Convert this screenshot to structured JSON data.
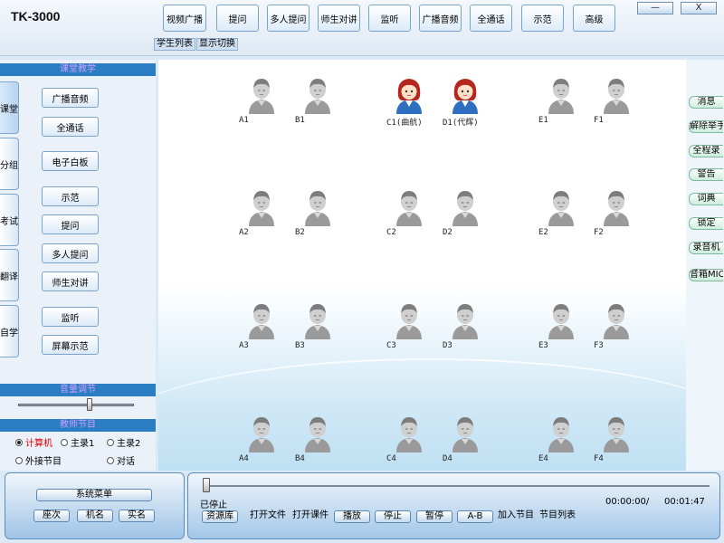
{
  "app": {
    "title": "TK-3000",
    "minimize_label": "—",
    "close_label": "X"
  },
  "toolbar": {
    "buttons": [
      "视频广播",
      "提问",
      "多人提问",
      "师生对讲",
      "监听",
      "广播音频",
      "全通话",
      "示范",
      "高级"
    ]
  },
  "subtabs": [
    "学生列表",
    "显示切换"
  ],
  "left_panel": {
    "header": "课堂教学",
    "vertical_tabs": [
      {
        "label": "课堂",
        "active": true
      },
      {
        "label": "分组",
        "active": false
      },
      {
        "label": "考试",
        "active": false
      },
      {
        "label": "翻译",
        "active": false
      },
      {
        "label": "自学",
        "active": false
      }
    ],
    "buttons": [
      "广播音频",
      "全通话",
      "电子白板",
      "示范",
      "提问",
      "多人提问",
      "师生对讲",
      "监听",
      "屏幕示范"
    ],
    "volume_header": "音量调节",
    "volume_level": 0.62,
    "program_header": "教师节目",
    "program_options": [
      {
        "label": "计算机",
        "checked": true
      },
      {
        "label": "主录1",
        "checked": false
      },
      {
        "label": "主录2",
        "checked": false
      },
      {
        "label": "外接节目",
        "checked": false
      },
      {
        "label": "对话",
        "checked": false
      }
    ]
  },
  "seats": [
    [
      "A1",
      "B1",
      "C1(曲航)",
      "D1(代辉)",
      "E1",
      "F1"
    ],
    [
      "A2",
      "B2",
      "C2",
      "D2",
      "E2",
      "F2"
    ],
    [
      "A3",
      "B3",
      "C3",
      "D3",
      "E3",
      "F3"
    ],
    [
      "A4",
      "B4",
      "C4",
      "D4",
      "E4",
      "F4"
    ]
  ],
  "online_seats": [
    "C1(曲航)",
    "D1(代辉)"
  ],
  "colors": {
    "online_hair": "#b5261e",
    "online_body": "#2f6fc1",
    "offline_body": "#9a9a9a",
    "header_bg": "#2b7dc4"
  },
  "right_buttons": [
    "消息",
    "解除举手",
    "全程录",
    "警告",
    "词典",
    "锁定",
    "录音机",
    "音箱MIC"
  ],
  "bottom_left": {
    "menu_label": "系统菜单",
    "buttons": [
      "座次",
      "机名",
      "实名"
    ]
  },
  "player": {
    "status": "已停止",
    "time_current": "00:00:00/",
    "time_total": "00:01:47",
    "progress": 0,
    "buttons": [
      "资源库",
      "打开文件",
      "打开课件",
      "播放",
      "停止",
      "暂停",
      "A-B",
      "加入节目",
      "节目列表"
    ]
  }
}
